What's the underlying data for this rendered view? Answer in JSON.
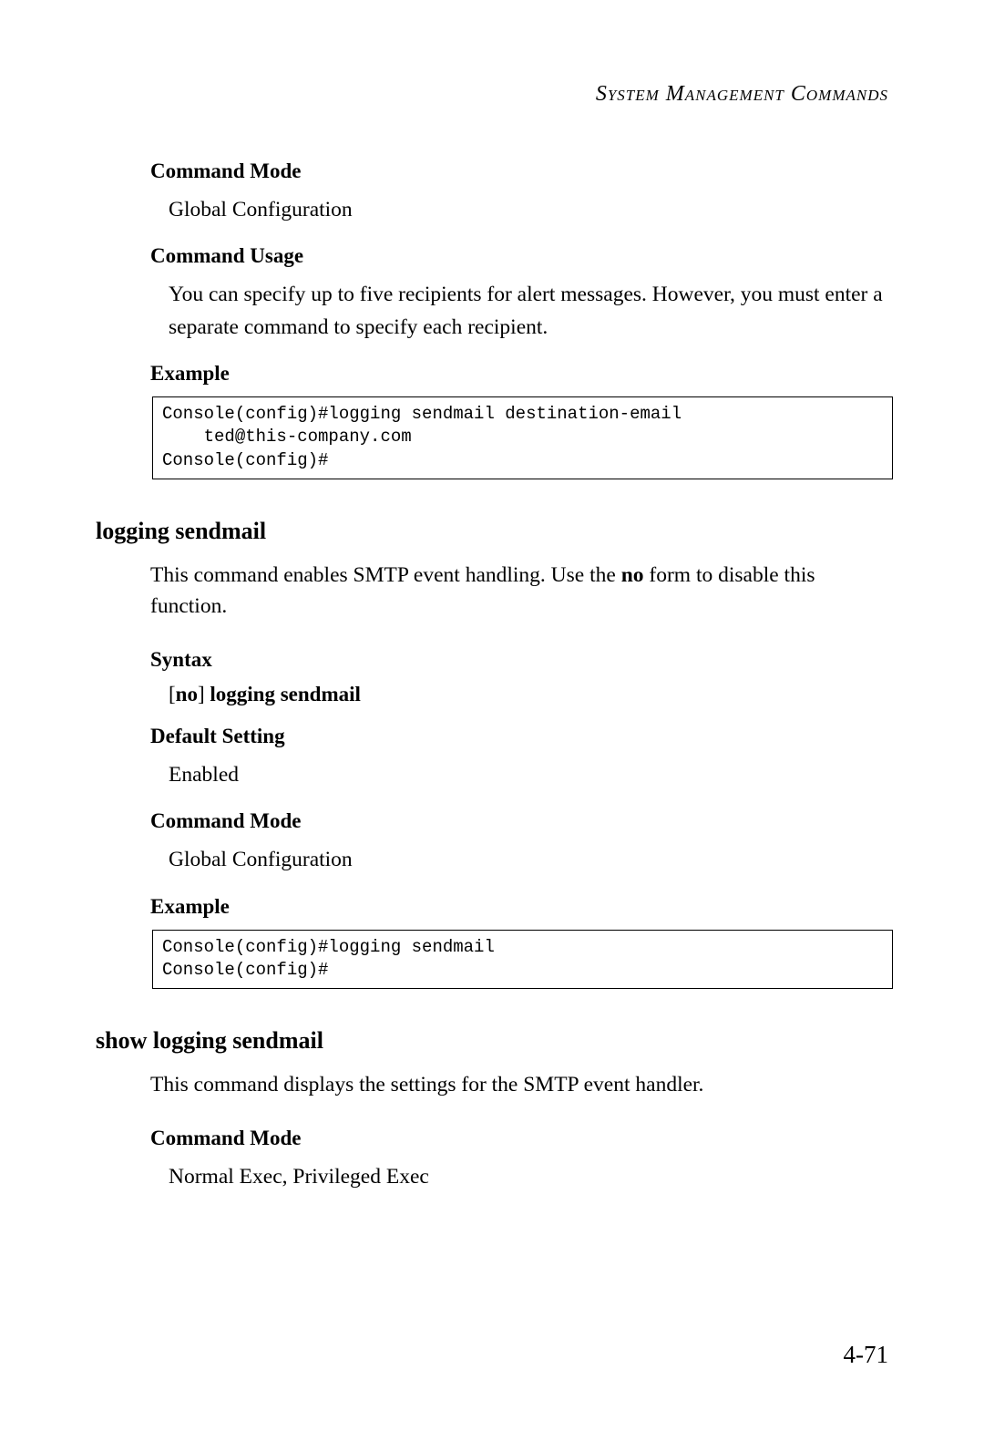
{
  "header": "System Management Commands",
  "section1": {
    "cmdModeLabel": "Command Mode",
    "cmdModeText": "Global Configuration",
    "cmdUsageLabel": "Command Usage",
    "cmdUsageText": "You can specify up to five recipients for alert messages. However, you must enter a separate command to specify each recipient.",
    "exampleLabel": "Example",
    "exampleCode": "Console(config)#logging sendmail destination-email \n    ted@this-company.com\nConsole(config)#"
  },
  "section2": {
    "title": "logging sendmail",
    "introPart1": "This command enables SMTP event handling. Use the ",
    "introBold": "no",
    "introPart2": " form to disable this function.",
    "syntaxLabel": "Syntax",
    "syntaxTextPrefix": "[",
    "syntaxTextBold1": "no",
    "syntaxTextMid": "] ",
    "syntaxTextBold2": "logging sendmail",
    "defaultLabel": "Default Setting",
    "defaultText": "Enabled",
    "cmdModeLabel": "Command Mode",
    "cmdModeText": "Global Configuration",
    "exampleLabel": "Example",
    "exampleCode": "Console(config)#logging sendmail\nConsole(config)#"
  },
  "section3": {
    "title": "show logging sendmail",
    "introText": "This command displays the settings for the SMTP event handler.",
    "cmdModeLabel": "Command Mode",
    "cmdModeText": "Normal Exec, Privileged Exec"
  },
  "pageNumber": "4-71"
}
